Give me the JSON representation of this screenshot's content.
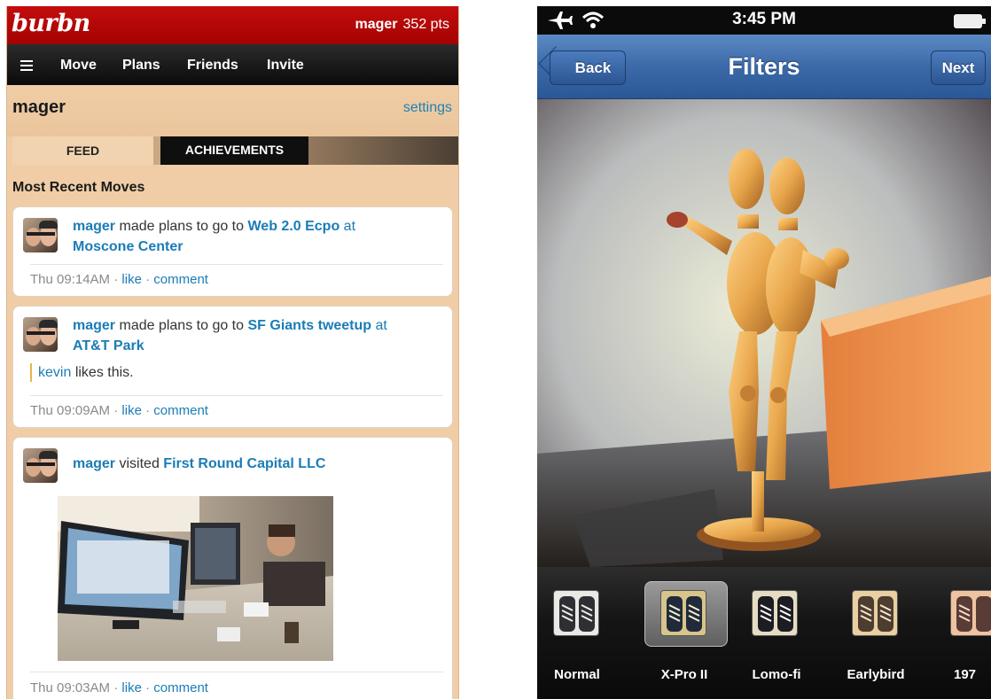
{
  "burbn": {
    "logo": "burbn",
    "user": {
      "name": "mager",
      "points": "352 pts"
    },
    "nav": [
      "Move",
      "Plans",
      "Friends",
      "Invite"
    ],
    "profile": {
      "name": "mager",
      "settings_label": "settings"
    },
    "tabs": {
      "feed": "FEED",
      "achievements": "ACHIEVEMENTS"
    },
    "section_title": "Most Recent Moves",
    "posts": [
      {
        "user": "mager",
        "action": "made plans to go to",
        "target": "Web 2.0 Ecpo",
        "connector": "at",
        "place": "Moscone Center",
        "time": "Thu 09:14AM",
        "like": "like",
        "comment": "comment"
      },
      {
        "user": "mager",
        "action": "made plans to go to",
        "target": "SF Giants tweetup",
        "connector": "at",
        "place": "AT&T Park",
        "liker": "kevin",
        "likes_text": "likes this.",
        "time": "Thu 09:09AM",
        "like": "like",
        "comment": "comment"
      },
      {
        "user": "mager",
        "action": "visited",
        "target": "First Round Capital LLC",
        "time": "Thu 09:03AM",
        "like": "like",
        "comment": "comment"
      }
    ],
    "separator": "·"
  },
  "iphone": {
    "status_time": "3:45 PM",
    "title": "Filters",
    "back_label": "Back",
    "next_label": "Next",
    "filters": [
      "Normal",
      "X-Pro II",
      "Lomo-fi",
      "Earlybird",
      "197"
    ],
    "selected_filter": "X-Pro II"
  }
}
